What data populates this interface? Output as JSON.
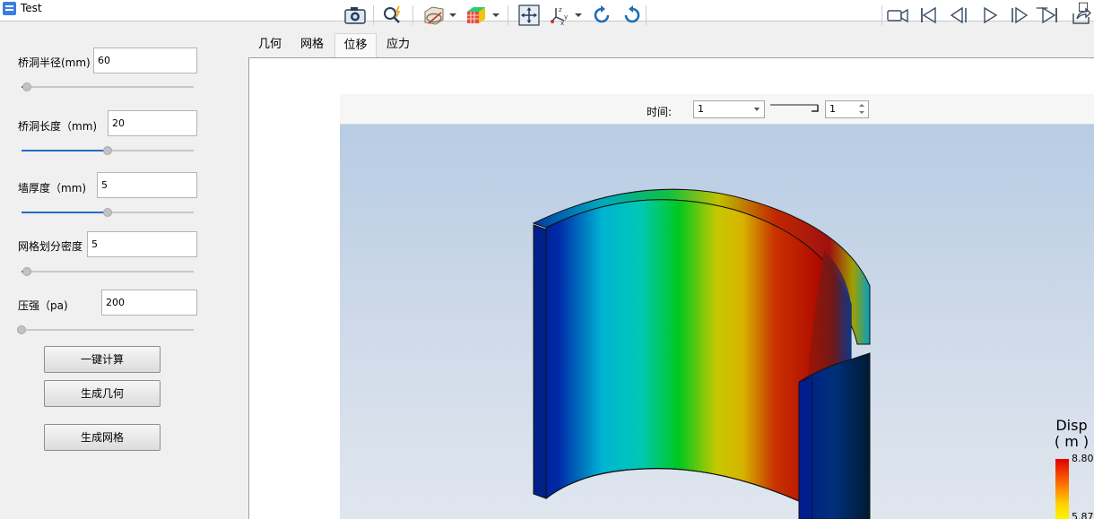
{
  "window": {
    "title": "Test",
    "minimize_symbol": "—",
    "maximize_symbol": "☐"
  },
  "panel": {
    "radius": {
      "label": "桥洞半径(mm)",
      "value": "60",
      "slider_fraction": 0.03
    },
    "length": {
      "label": "桥洞长度（mm)",
      "value": "20",
      "slider_fraction": 0.5
    },
    "wall": {
      "label": "墙厚度（mm)",
      "value": "5",
      "slider_fraction": 0.5
    },
    "mesh": {
      "label": "网格划分密度",
      "value": "5",
      "slider_fraction": 0.03
    },
    "pressure": {
      "label": "压强（pa)",
      "value": "200",
      "slider_fraction": 0.0
    },
    "buttons": {
      "compute": "一键计算",
      "geometry": "生成几何",
      "mesh": "生成网格"
    }
  },
  "tabs": [
    {
      "label": "几何",
      "active": false
    },
    {
      "label": "网格",
      "active": false
    },
    {
      "label": "位移",
      "active": true
    },
    {
      "label": "应力",
      "active": false
    }
  ],
  "toolbar": {
    "time_label": "时间:",
    "time_combo_value": "1",
    "frame_spin_value": "1",
    "icons": [
      "camera-icon",
      "zoom-to-box-icon",
      "visibility-icon",
      "color-map-icon",
      "reset-camera-icon",
      "axes-icon",
      "rotate-cw-icon",
      "rotate-ccw-icon",
      "record-icon",
      "first-frame-icon",
      "prev-frame-icon",
      "play-icon",
      "next-frame-icon",
      "last-frame-icon",
      "export-icon"
    ]
  },
  "legend": {
    "title_line1": "Disp",
    "title_line2": "( m )",
    "max": "8.80",
    "min": "5.87"
  },
  "colors": {
    "accent": "#1d6fc5",
    "viewport_top": "#b7cce3",
    "viewport_bottom": "#e0e6ee"
  }
}
